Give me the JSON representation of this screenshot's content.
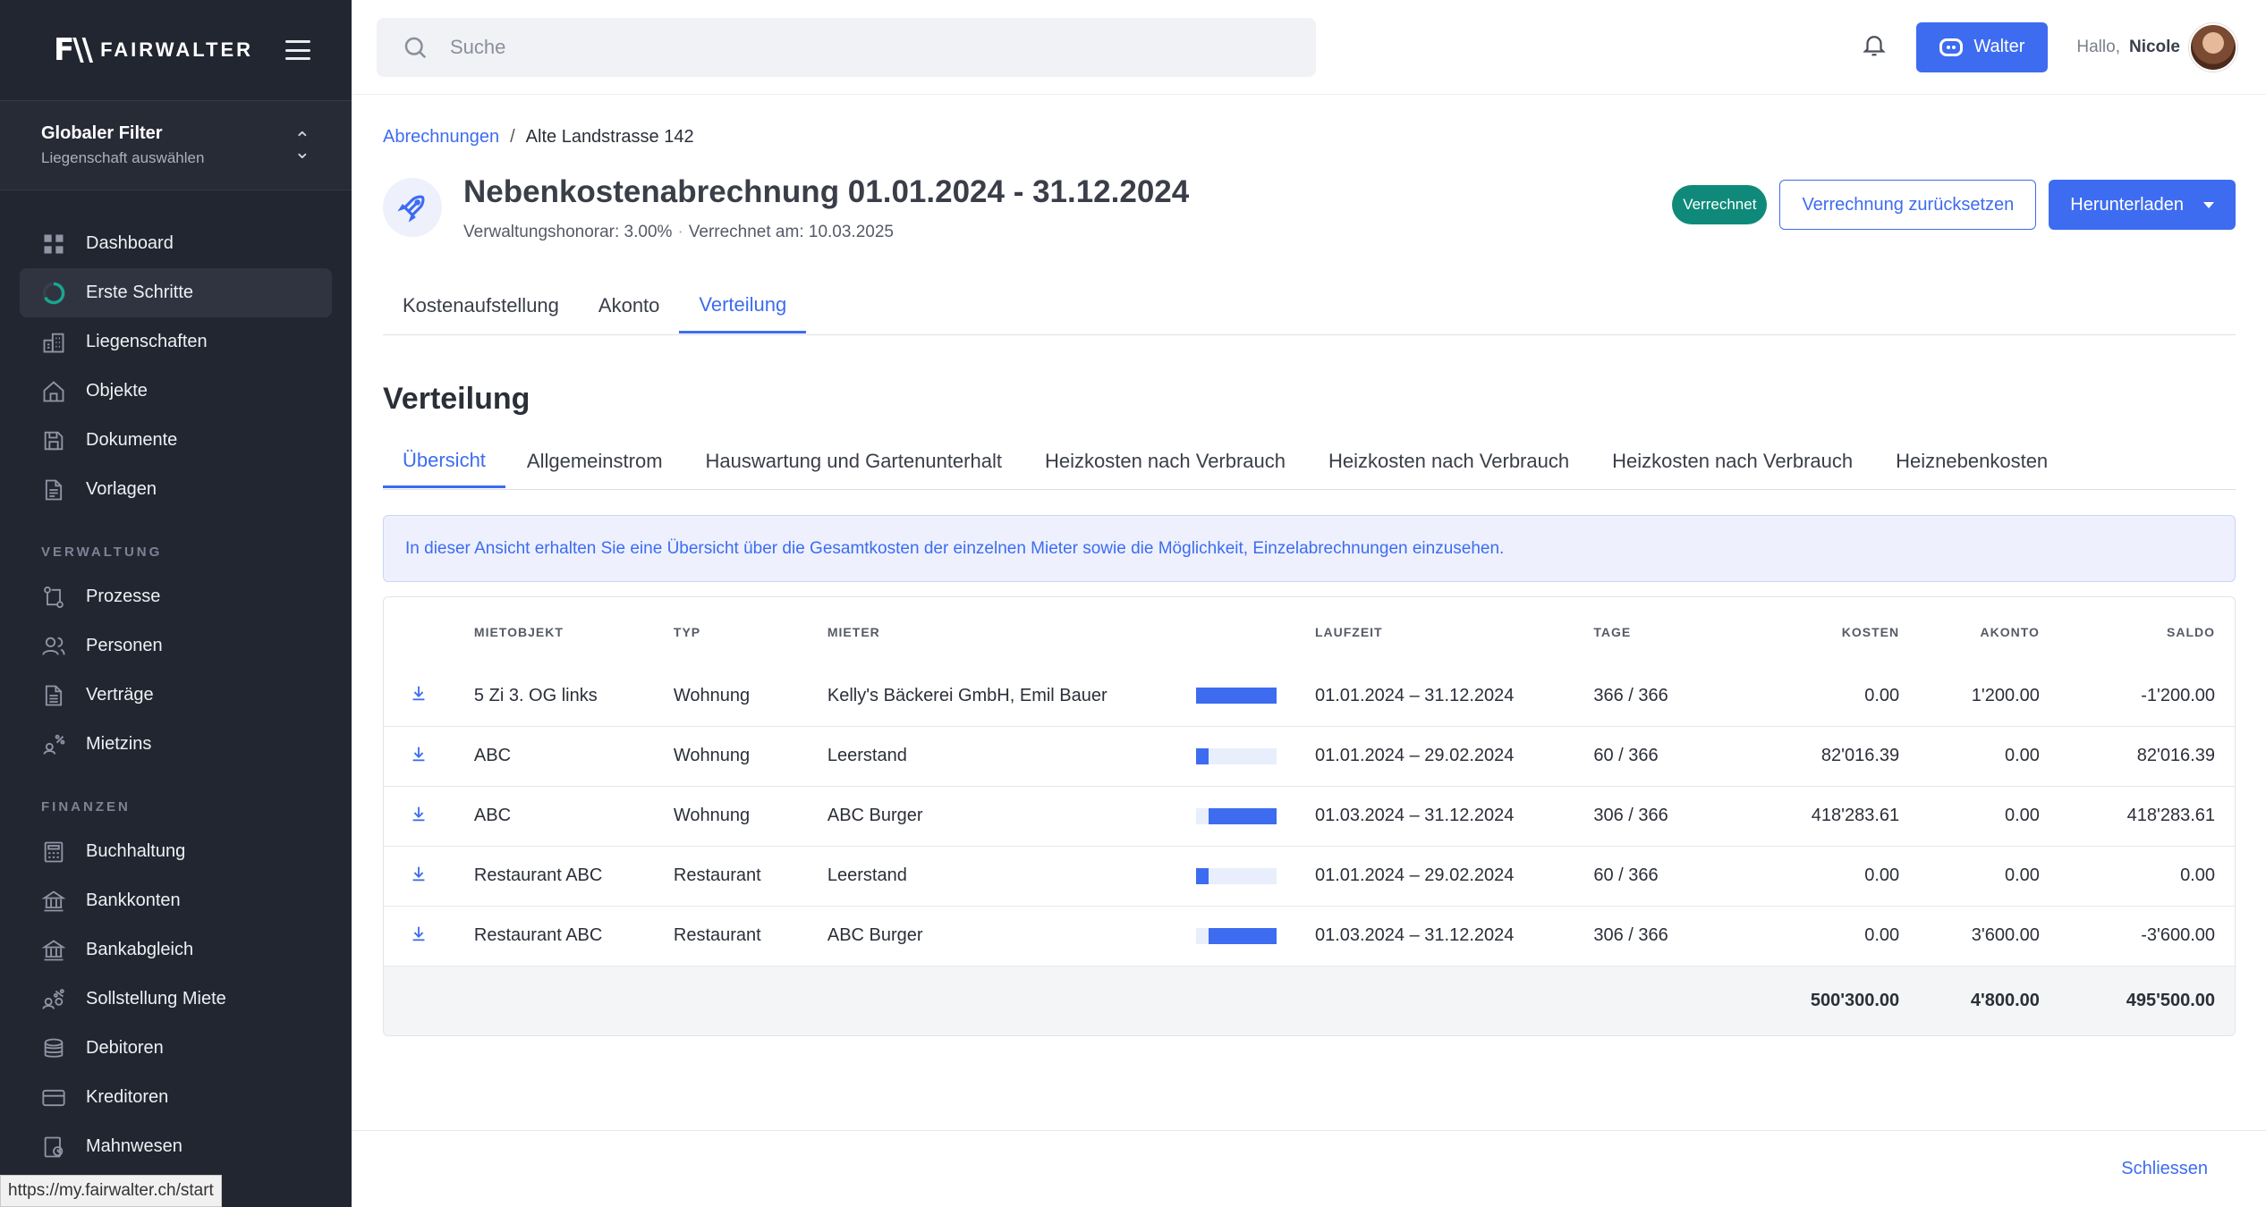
{
  "brand": {
    "name": "FAIRWALTER",
    "logo_mark": "F\\\\"
  },
  "global_filter": {
    "title": "Globaler Filter",
    "subtitle": "Liegenschaft auswählen"
  },
  "nav": {
    "main": [
      {
        "label": "Dashboard",
        "icon": "dashboard-icon"
      },
      {
        "label": "Erste Schritte",
        "icon": "progress-ring-icon",
        "active": true
      },
      {
        "label": "Liegenschaften",
        "icon": "buildings-icon"
      },
      {
        "label": "Objekte",
        "icon": "home-icon"
      },
      {
        "label": "Dokumente",
        "icon": "folder-icon"
      },
      {
        "label": "Vorlagen",
        "icon": "document-icon"
      }
    ],
    "section_verwaltung": "VERWALTUNG",
    "verwaltung": [
      {
        "label": "Prozesse",
        "icon": "process-icon"
      },
      {
        "label": "Personen",
        "icon": "people-icon"
      },
      {
        "label": "Verträge",
        "icon": "contract-icon"
      },
      {
        "label": "Mietzins",
        "icon": "rent-icon"
      }
    ],
    "section_finanzen": "FINANZEN",
    "finanzen": [
      {
        "label": "Buchhaltung",
        "icon": "calculator-icon"
      },
      {
        "label": "Bankkonten",
        "icon": "bank-icon"
      },
      {
        "label": "Bankabgleich",
        "icon": "bank-sync-icon"
      },
      {
        "label": "Sollstellung Miete",
        "icon": "percent-people-icon"
      },
      {
        "label": "Debitoren",
        "icon": "coins-icon"
      },
      {
        "label": "Kreditoren",
        "icon": "card-icon"
      },
      {
        "label": "Mahnwesen",
        "icon": "reminder-icon"
      }
    ]
  },
  "status_url": "https://my.fairwalter.ch/start",
  "topbar": {
    "search_placeholder": "Suche",
    "assistant_label": "Walter",
    "greeting": "Hallo,",
    "user_name": "Nicole"
  },
  "breadcrumb": {
    "parent": "Abrechnungen",
    "separator": "/",
    "current": "Alte Landstrasse 142"
  },
  "header": {
    "title": "Nebenkostenabrechnung 01.01.2024 - 31.12.2024",
    "fee": "Verwaltungshonorar: 3.00%",
    "dot": "·",
    "settled": "Verrechnet am: 10.03.2025",
    "status_badge": "Verrechnet",
    "reset_button": "Verrechnung zurücksetzen",
    "download_button": "Herunterladen"
  },
  "tabs": [
    "Kostenaufstellung",
    "Akonto",
    "Verteilung"
  ],
  "active_tab": 2,
  "section_title": "Verteilung",
  "subtabs": [
    "Übersicht",
    "Allgemeinstrom",
    "Hauswartung und Gartenunterhalt",
    "Heizkosten nach Verbrauch",
    "Heizkosten nach Verbrauch",
    "Heizkosten nach Verbrauch",
    "Heiznebenkosten"
  ],
  "active_subtab": 0,
  "info_text": "In dieser Ansicht erhalten Sie eine Übersicht über die Gesamtkosten der einzelnen Mieter sowie die Möglichkeit, Einzelabrechnungen einzusehen.",
  "table": {
    "headers": {
      "object": "MIETOBJEKT",
      "type": "TYP",
      "tenant": "MIETER",
      "period": "LAUFZEIT",
      "days": "TAGE",
      "costs": "KOSTEN",
      "akonto": "AKONTO",
      "saldo": "SALDO"
    },
    "rows": [
      {
        "object": "5 Zi 3. OG links",
        "type": "Wohnung",
        "tenant": "Kelly's Bäckerei GmbH, Emil Bauer",
        "bar_start": 0.0,
        "bar_share": 1.0,
        "period": "01.01.2024 – 31.12.2024",
        "days": "366 / 366",
        "costs": "0.00",
        "akonto": "1'200.00",
        "saldo": "-1'200.00"
      },
      {
        "object": "ABC",
        "type": "Wohnung",
        "tenant": "Leerstand",
        "bar_start": 0.0,
        "bar_share": 0.164,
        "period": "01.01.2024 – 29.02.2024",
        "days": "60 / 366",
        "costs": "82'016.39",
        "akonto": "0.00",
        "saldo": "82'016.39"
      },
      {
        "object": "ABC",
        "type": "Wohnung",
        "tenant": "ABC Burger",
        "bar_start": 0.164,
        "bar_share": 0.836,
        "period": "01.03.2024 – 31.12.2024",
        "days": "306 / 366",
        "costs": "418'283.61",
        "akonto": "0.00",
        "saldo": "418'283.61"
      },
      {
        "object": "Restaurant ABC",
        "type": "Restaurant",
        "tenant": "Leerstand",
        "bar_start": 0.0,
        "bar_share": 0.164,
        "period": "01.01.2024 – 29.02.2024",
        "days": "60 / 366",
        "costs": "0.00",
        "akonto": "0.00",
        "saldo": "0.00"
      },
      {
        "object": "Restaurant ABC",
        "type": "Restaurant",
        "tenant": "ABC Burger",
        "bar_start": 0.164,
        "bar_share": 0.836,
        "period": "01.03.2024 – 31.12.2024",
        "days": "306 / 366",
        "costs": "0.00",
        "akonto": "3'600.00",
        "saldo": "-3'600.00"
      }
    ],
    "totals": {
      "costs": "500'300.00",
      "akonto": "4'800.00",
      "saldo": "495'500.00"
    }
  },
  "footer": {
    "close": "Schliessen"
  },
  "colors": {
    "accent": "#3d6cf0",
    "sidebar": "#222630",
    "badge": "#0f8a7a"
  }
}
